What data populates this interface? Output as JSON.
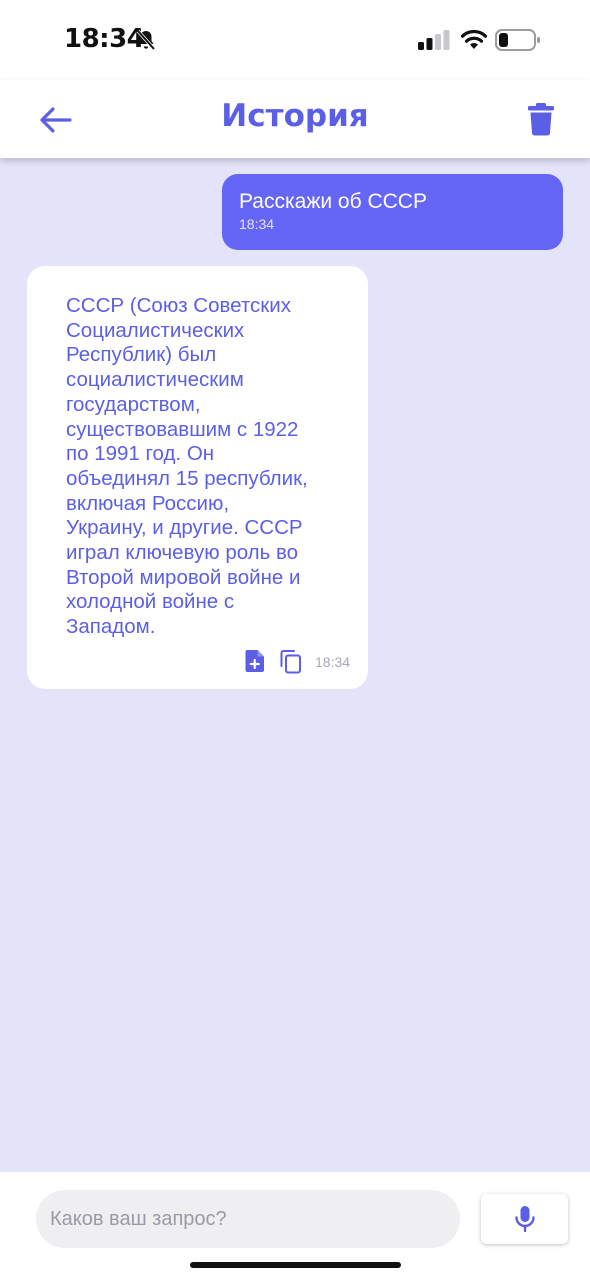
{
  "status_bar": {
    "time": "18:34"
  },
  "header": {
    "title": "История"
  },
  "messages": [
    {
      "role": "user",
      "text": "Расскажи об СССР",
      "time": "18:34"
    },
    {
      "role": "assistant",
      "text": "СССР (Союз Советских\nСоциалистических\nРеспублик) был\nсоциалистическим\nгосударством,\nсуществовавшим с 1922\nпо 1991 год. Он\nобъединял 15 республик,\nвключая Россию,\nУкраину, и другие. СССР\nиграл ключевую роль во\nВторой мировой войне и\nхолодной войне с\nЗападом.",
      "time": "18:34"
    }
  ],
  "input": {
    "placeholder": "Каков ваш запрос?",
    "value": ""
  },
  "colors": {
    "accent": "#5b5fe6",
    "user_bubble": "#6566f6",
    "chat_background": "#e3e4f9"
  },
  "icons": {
    "back": "arrow-left-icon",
    "delete": "trash-icon",
    "add_document": "add-document-icon",
    "copy": "copy-icon",
    "microphone": "microphone-icon"
  }
}
